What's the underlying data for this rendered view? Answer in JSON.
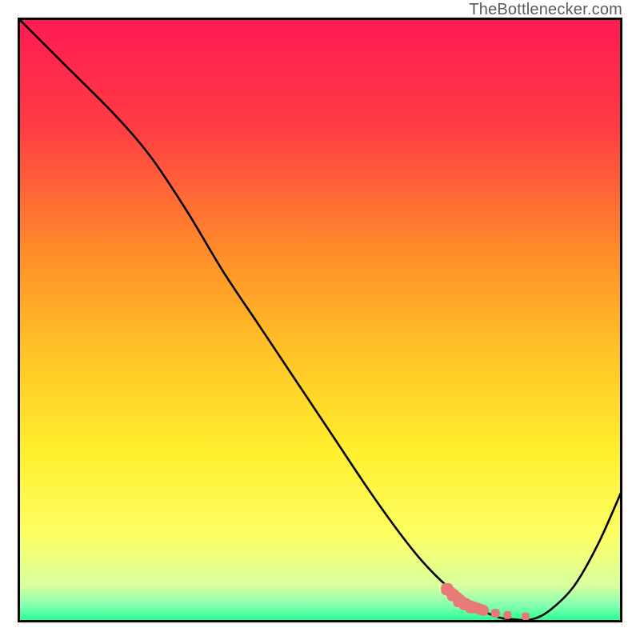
{
  "attribution": "TheBottlenecker.com",
  "chart_data": {
    "type": "line",
    "title": "",
    "xlabel": "",
    "ylabel": "",
    "xlim": [
      0,
      100
    ],
    "ylim": [
      0,
      100
    ],
    "series": [
      {
        "name": "bottleneck-curve",
        "x": [
          0,
          8,
          16,
          22,
          28,
          34,
          40,
          46,
          52,
          58,
          63,
          67,
          71,
          75,
          79,
          82,
          85,
          88,
          92,
          96,
          100
        ],
        "y": [
          100,
          92,
          84,
          77,
          68,
          58,
          49,
          40,
          31,
          22,
          15,
          10,
          6,
          3,
          1,
          0.5,
          0.5,
          2,
          6,
          13,
          22
        ]
      }
    ],
    "highlight_points": {
      "name": "marked-segment",
      "x": [
        71,
        72,
        73,
        74,
        75,
        77,
        79,
        81,
        84
      ],
      "y": [
        5.5,
        4.5,
        3.5,
        3,
        2.5,
        2,
        1.5,
        1.2,
        1
      ]
    },
    "gradient_stops": [
      {
        "offset": 0,
        "color": "#ff1a53"
      },
      {
        "offset": 0.18,
        "color": "#ff3b44"
      },
      {
        "offset": 0.38,
        "color": "#ff8a2a"
      },
      {
        "offset": 0.55,
        "color": "#ffc226"
      },
      {
        "offset": 0.72,
        "color": "#fff02e"
      },
      {
        "offset": 0.86,
        "color": "#fcff66"
      },
      {
        "offset": 0.94,
        "color": "#d8ffa0"
      },
      {
        "offset": 0.975,
        "color": "#7bffb0"
      },
      {
        "offset": 1.0,
        "color": "#18ff8a"
      }
    ]
  }
}
